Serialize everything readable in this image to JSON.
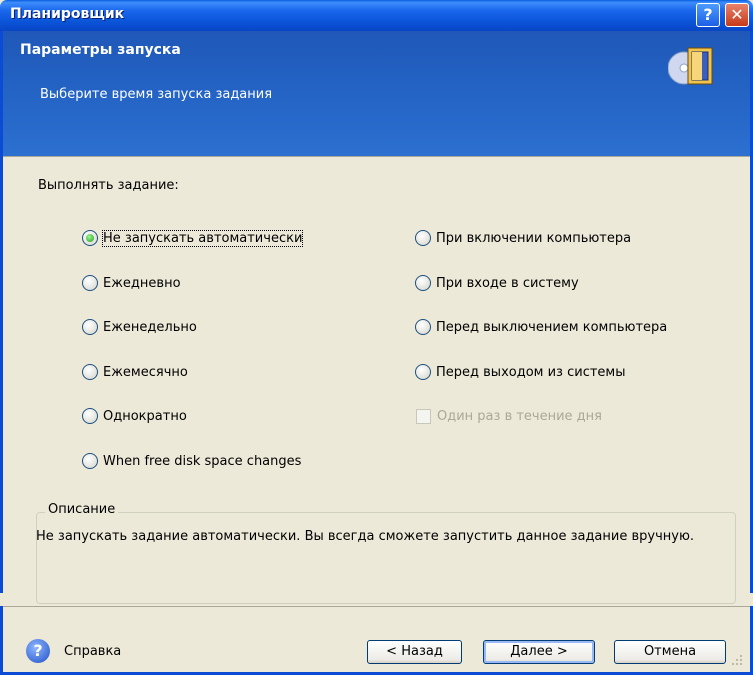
{
  "window": {
    "title": "Планировщик"
  },
  "header": {
    "title": "Параметры запуска",
    "subtitle": "Выберите время запуска задания"
  },
  "run": {
    "label": "Выполнять задание:",
    "left_options": [
      "Не запускать автоматически",
      "Ежедневно",
      "Еженедельно",
      "Ежемесячно",
      "Однократно",
      "When free disk space changes"
    ],
    "right_options": [
      "При включении компьютера",
      "При входе в систему",
      "Перед выключением компьютера",
      "Перед выходом из системы"
    ],
    "selected": "Не запускать автоматически",
    "once_per_day_label": "Один раз в течение дня"
  },
  "description": {
    "legend": "Описание",
    "text": "Не запускать задание автоматически. Вы всегда сможете запустить данное задание вручную."
  },
  "footer": {
    "help": "Справка",
    "back": "< Назад",
    "next": "Далее >",
    "cancel": "Отмена"
  },
  "colors": {
    "title_bar": "#0a54d8",
    "header": "#2566c7",
    "background": "#ece9d8"
  },
  "icons": [
    "help-icon",
    "close-icon",
    "wizard-icon",
    "help-circle-icon",
    "resize-grip-icon"
  ]
}
